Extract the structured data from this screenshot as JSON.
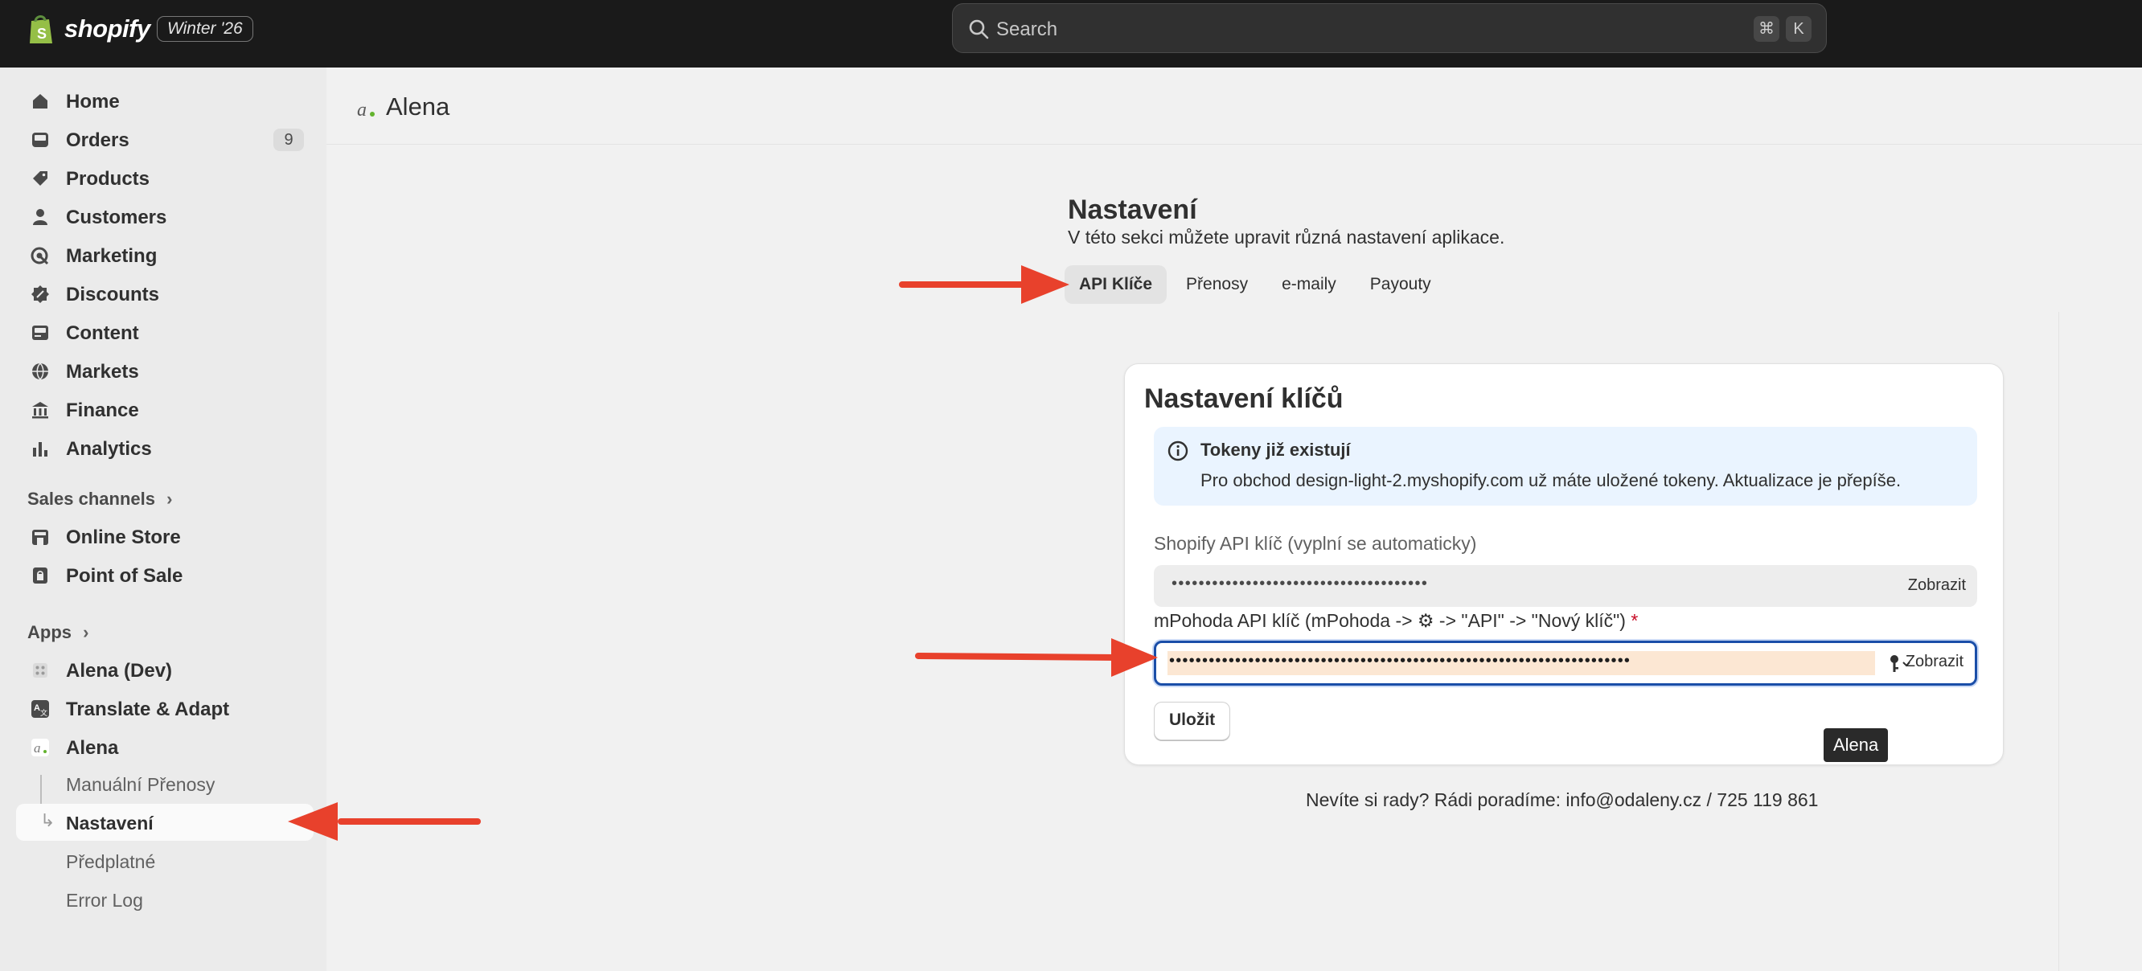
{
  "topbar": {
    "brand": "shopify",
    "edition_badge": "Winter '26",
    "search_placeholder": "Search",
    "shortcut_cmd": "⌘",
    "shortcut_key": "K"
  },
  "sidebar": {
    "items": [
      {
        "label": "Home",
        "icon": "home-icon"
      },
      {
        "label": "Orders",
        "icon": "inbox-icon",
        "count": "9"
      },
      {
        "label": "Products",
        "icon": "tag-icon"
      },
      {
        "label": "Customers",
        "icon": "person-icon"
      },
      {
        "label": "Marketing",
        "icon": "target-icon"
      },
      {
        "label": "Discounts",
        "icon": "discount-icon"
      },
      {
        "label": "Content",
        "icon": "content-icon"
      },
      {
        "label": "Markets",
        "icon": "globe-icon"
      },
      {
        "label": "Finance",
        "icon": "bank-icon"
      },
      {
        "label": "Analytics",
        "icon": "bar-chart-icon"
      }
    ],
    "sales_channels_heading": "Sales channels",
    "sales_channels": [
      {
        "label": "Online Store",
        "icon": "store-icon"
      },
      {
        "label": "Point of Sale",
        "icon": "pos-icon"
      }
    ],
    "apps_heading": "Apps",
    "apps": [
      {
        "label": "Alena (Dev)",
        "icon": "app-grid-icon"
      },
      {
        "label": "Translate & Adapt",
        "icon": "translate-icon"
      },
      {
        "label": "Alena",
        "icon": "alena-logo-icon"
      }
    ],
    "app_subitems": [
      {
        "label": "Manuální Přenosy"
      },
      {
        "label": "Nastavení",
        "active": true
      },
      {
        "label": "Předplatné"
      },
      {
        "label": "Error Log"
      }
    ]
  },
  "main": {
    "app_title": "Alena",
    "settings_title": "Nastavení",
    "settings_subtitle": "V této sekci můžete upravit různá nastavení aplikace.",
    "tabs": [
      {
        "label": "API Klíče",
        "active": true
      },
      {
        "label": "Přenosy"
      },
      {
        "label": "e-maily"
      },
      {
        "label": "Payouty"
      }
    ],
    "card": {
      "title": "Nastavení klíčů",
      "banner_title": "Tokeny již existují",
      "banner_text": "Pro obchod design-light-2.myshopify.com už máte uložené tokeny. Aktualizace je přepíše.",
      "field1_label": "Shopify API klíč (vyplní se automaticky)",
      "field1_value": "••••••••••••••••••••••••••••••••••••••",
      "field1_toggle": "Zobrazit",
      "field2_label": "mPohoda API klíč (mPohoda -> ⚙ -> \"API\" -> \"Nový klíč\")",
      "field2_required": "*",
      "field2_value": "••••••••••••••••••••••••••••••••••••••••••••••••••••••••••••••••••••••",
      "field2_toggle": "Zobrazit",
      "save_label": "Uložit"
    },
    "tooltip": "Alena",
    "help_text": "Nevíte si rady? Rádi poradíme: info@odaleny.cz / 725 119 861"
  },
  "colors": {
    "topbar": "#1a1a1a",
    "sidebar": "#ebebeb",
    "banner": "#eaf4ff",
    "focus_border": "#1a4ea8",
    "annotation_arrow": "#e8412c"
  }
}
